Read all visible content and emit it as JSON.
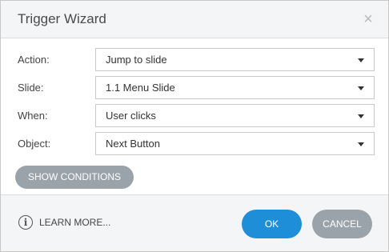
{
  "dialog": {
    "title": "Trigger Wizard",
    "close_glyph": "×"
  },
  "fields": [
    {
      "label": "Action:",
      "value": "Jump to slide"
    },
    {
      "label": "Slide:",
      "value": "1.1 Menu Slide"
    },
    {
      "label": "When:",
      "value": "User clicks"
    },
    {
      "label": "Object:",
      "value": "Next Button"
    }
  ],
  "buttons": {
    "show_conditions": "SHOW CONDITIONS",
    "learn_more": "LEARN MORE...",
    "ok": "OK",
    "cancel": "CANCEL"
  },
  "icons": {
    "info": "i",
    "close": "close-icon",
    "dropdown": "chevron-down-icon"
  },
  "colors": {
    "primary": "#1f8ed9",
    "secondary": "#9aa3aa",
    "header_bg": "#f4f5f6"
  }
}
